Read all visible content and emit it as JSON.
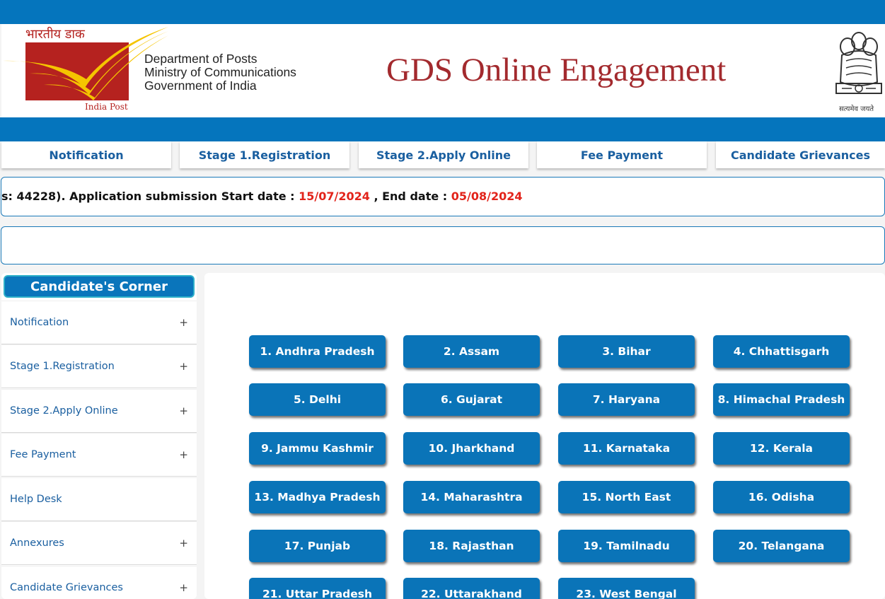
{
  "header": {
    "logo_hindi": "भारतीय डाक",
    "logo_caption": "India Post",
    "dept_line1": "Department of Posts",
    "dept_line2": "Ministry of Communications",
    "dept_line3": "Government of India",
    "site_title": "GDS Online Engagement",
    "emblem_motto": "सत्यमेव जयते"
  },
  "topnav": [
    {
      "label": "Notification"
    },
    {
      "label": "Stage 1.Registration"
    },
    {
      "label": "Stage 2.Apply Online"
    },
    {
      "label": "Fee Payment"
    },
    {
      "label": "Candidate Grievances"
    }
  ],
  "marquee": {
    "prefix": "s: 44228). Application submission Start date : ",
    "start_date": "15/07/2024",
    "middle": " , End date : ",
    "end_date": "05/08/2024"
  },
  "sidebar": {
    "title": "Candidate's Corner",
    "items": [
      {
        "label": "Notification",
        "expand": "+"
      },
      {
        "label": "Stage 1.Registration",
        "expand": "+"
      },
      {
        "label": "Stage 2.Apply Online",
        "expand": "+"
      },
      {
        "label": "Fee Payment",
        "expand": "+"
      },
      {
        "label": "Help Desk",
        "expand": ""
      },
      {
        "label": "Annexures",
        "expand": "+"
      },
      {
        "label": "Candidate Grievances",
        "expand": "+"
      }
    ]
  },
  "states": [
    "1. Andhra Pradesh",
    "2. Assam",
    "3. Bihar",
    "4. Chhattisgarh",
    "5. Delhi",
    "6. Gujarat",
    "7. Haryana",
    "8. Himachal Pradesh",
    "9. Jammu Kashmir",
    "10. Jharkhand",
    "11. Karnataka",
    "12. Kerala",
    "13. Madhya Pradesh",
    "14. Maharashtra",
    "15. North East",
    "16. Odisha",
    "17. Punjab",
    "18. Rajasthan",
    "19. Tamilnadu",
    "20. Telangana",
    "21. Uttar Pradesh",
    "22. Uttarakhand",
    "23. West Bengal"
  ],
  "colors": {
    "brand_blue": "#0575bd",
    "title_red": "#a32a2e",
    "date_red": "#e2231a",
    "logo_red": "#b5221f",
    "logo_yellow": "#f5c400"
  }
}
